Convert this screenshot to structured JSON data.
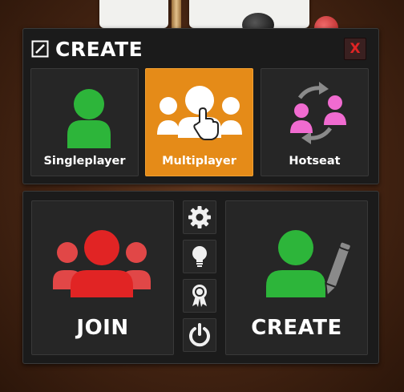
{
  "create_panel": {
    "title": "CREATE",
    "close_label": "X",
    "modes": [
      {
        "label": "Singleplayer",
        "icon": "single-user-icon",
        "selected": false
      },
      {
        "label": "Multiplayer",
        "icon": "multi-user-icon",
        "selected": true
      },
      {
        "label": "Hotseat",
        "icon": "hotseat-swap-icon",
        "selected": false
      }
    ]
  },
  "main_panel": {
    "join_label": "JOIN",
    "create_label": "CREATE",
    "side_buttons": [
      "gear-icon",
      "lightbulb-icon",
      "award-ribbon-icon",
      "power-icon"
    ]
  },
  "colors": {
    "selected_accent": "#e58b18",
    "single_user": "#2db53a",
    "hotseat_users": "#f06bd0",
    "join_users": "#e12424",
    "close_x": "#e02424"
  }
}
